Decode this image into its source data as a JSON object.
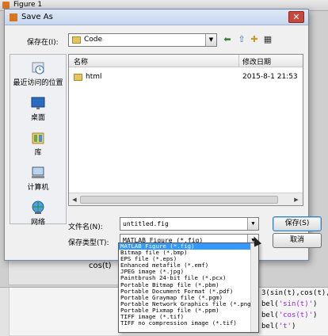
{
  "figure": {
    "title": "Figure 1",
    "axis_label": "cos(t)",
    "code_lines": [
      [
        "3(sin(t),cos(t),t",
        ""
      ],
      [
        "bel(",
        "'sin(t)'",
        ")"
      ],
      [
        "bel(",
        "'cos(t)'",
        ")"
      ],
      [
        "bel(",
        "'t'",
        ")"
      ]
    ]
  },
  "dialog": {
    "title": "Save As",
    "close_glyph": "✕",
    "save_in_label": "保存在(I):",
    "location": "Code",
    "places": [
      {
        "label": "最近访问的位置",
        "icon": "recent-places-icon"
      },
      {
        "label": "桌面",
        "icon": "desktop-icon"
      },
      {
        "label": "库",
        "icon": "libraries-icon"
      },
      {
        "label": "计算机",
        "icon": "computer-icon"
      },
      {
        "label": "网络",
        "icon": "network-icon"
      }
    ],
    "columns": {
      "name": "名称",
      "date": "修改日期"
    },
    "files": [
      {
        "name": "html",
        "date": "2015-8-1 21:53"
      }
    ],
    "filename_label": "文件名(N):",
    "filename_value": "untitled.fig",
    "filetype_label": "保存类型(T):",
    "filetype_value": "MATLAB Figure (*.fig)",
    "save_button": "保存(S)",
    "cancel_button": "取消",
    "file_types": [
      "MATLAB Figure (*.fig)",
      "Bitmap file (*.bmp)",
      "EPS file (*.eps)",
      "Enhanced metafile (*.emf)",
      "JPEG image (*.jpg)",
      "Paintbrush 24-bit file (*.pcx)",
      "Portable Bitmap file (*.pbm)",
      "Portable Document Format (*.pdf)",
      "Portable Graymap file (*.pgm)",
      "Portable Network Graphics file (*.png)",
      "Portable Pixmap file (*.ppm)",
      "TIFF image (*.tif)",
      "TIFF no compression image (*.tif)"
    ],
    "selected_type_index": 0
  }
}
